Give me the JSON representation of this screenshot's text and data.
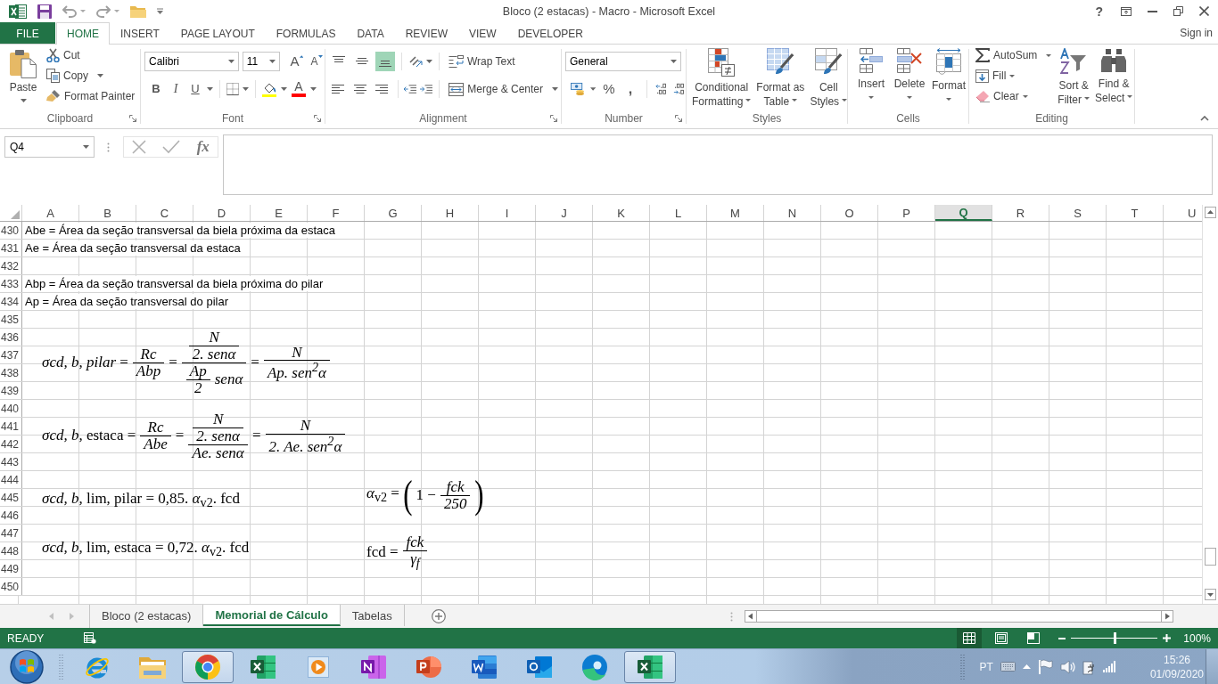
{
  "window": {
    "title": "Bloco (2 estacas) - Macro - Microsoft Excel",
    "help": "?"
  },
  "tabs": [
    {
      "label": "FILE",
      "kind": "file",
      "selected": false
    },
    {
      "label": "HOME",
      "kind": "tab",
      "selected": true
    },
    {
      "label": "INSERT",
      "kind": "tab",
      "selected": false
    },
    {
      "label": "PAGE LAYOUT",
      "kind": "tab",
      "selected": false
    },
    {
      "label": "FORMULAS",
      "kind": "tab",
      "selected": false
    },
    {
      "label": "DATA",
      "kind": "tab",
      "selected": false
    },
    {
      "label": "REVIEW",
      "kind": "tab",
      "selected": false
    },
    {
      "label": "VIEW",
      "kind": "tab",
      "selected": false
    },
    {
      "label": "DEVELOPER",
      "kind": "tab",
      "selected": false
    }
  ],
  "account": {
    "label": "Sign in"
  },
  "ribbon": {
    "clipboard": {
      "label": "Clipboard",
      "paste": "Paste",
      "cut": "Cut",
      "copy": "Copy",
      "format_painter": "Format Painter"
    },
    "font": {
      "label": "Font",
      "font_name": "Calibri",
      "font_size": "11",
      "grow": "A",
      "shrink": "A",
      "bold": "B",
      "italic": "I",
      "underline": "U",
      "font_color": "A"
    },
    "alignment": {
      "label": "Alignment",
      "vertical": [
        {
          "kind": "top",
          "selected": false
        },
        {
          "kind": "middle",
          "selected": false
        },
        {
          "kind": "bottom",
          "selected": true
        }
      ],
      "horizontal": [
        {
          "kind": "left",
          "selected": false
        },
        {
          "kind": "center",
          "selected": false
        },
        {
          "kind": "right",
          "selected": false
        }
      ],
      "wrap_text": "Wrap Text",
      "merge": "Merge & Center"
    },
    "number": {
      "label": "Number",
      "format": "General",
      "percent": "%",
      "comma": ","
    },
    "styles": {
      "label": "Styles",
      "buttons": [
        {
          "kind": "conditional",
          "lines": [
            "Conditional",
            "Formatting"
          ]
        },
        {
          "kind": "table",
          "lines": [
            "Format as",
            "Table"
          ]
        },
        {
          "kind": "cell",
          "lines": [
            "Cell",
            "Styles"
          ]
        }
      ]
    },
    "cells": {
      "label": "Cells",
      "buttons": [
        {
          "kind": "insert",
          "label": "Insert"
        },
        {
          "kind": "delete",
          "label": "Delete"
        },
        {
          "kind": "format",
          "label": "Format"
        }
      ]
    },
    "editing": {
      "label": "Editing",
      "autosum": "AutoSum",
      "fill": "Fill",
      "clear": "Clear",
      "buttons": [
        {
          "kind": "sort",
          "lines": [
            "Sort &",
            "Filter"
          ]
        },
        {
          "kind": "find",
          "lines": [
            "Find &",
            "Select"
          ]
        }
      ]
    }
  },
  "formula_bar": {
    "name_box": "Q4",
    "function_label": "fx"
  },
  "sheet": {
    "columns": [
      {
        "label": "A",
        "selected": false
      },
      {
        "label": "B",
        "selected": false
      },
      {
        "label": "C",
        "selected": false
      },
      {
        "label": "D",
        "selected": false
      },
      {
        "label": "E",
        "selected": false
      },
      {
        "label": "F",
        "selected": false
      },
      {
        "label": "G",
        "selected": false
      },
      {
        "label": "H",
        "selected": false
      },
      {
        "label": "I",
        "selected": false
      },
      {
        "label": "J",
        "selected": false
      },
      {
        "label": "K",
        "selected": false
      },
      {
        "label": "L",
        "selected": false
      },
      {
        "label": "M",
        "selected": false
      },
      {
        "label": "N",
        "selected": false
      },
      {
        "label": "O",
        "selected": false
      },
      {
        "label": "P",
        "selected": false
      },
      {
        "label": "Q",
        "selected": true
      },
      {
        "label": "R",
        "selected": false
      },
      {
        "label": "S",
        "selected": false
      },
      {
        "label": "T",
        "selected": false
      },
      {
        "label": "U",
        "selected": false
      }
    ],
    "rows": [
      {
        "number": "430",
        "text": "Abe = Área da seção transversal da biela próxima da estaca"
      },
      {
        "number": "431",
        "text": "Ae = Área da seção transversal da estaca"
      },
      {
        "number": "432"
      },
      {
        "number": "433",
        "text": "Abp = Área da seção transversal da biela próxima do pilar"
      },
      {
        "number": "434",
        "text": "Ap = Área da seção transversal do pilar"
      },
      {
        "number": "435"
      },
      {
        "number": "436"
      },
      {
        "number": "437"
      },
      {
        "number": "438"
      },
      {
        "number": "439"
      },
      {
        "number": "440"
      },
      {
        "number": "441"
      },
      {
        "number": "442"
      },
      {
        "number": "443"
      },
      {
        "number": "444"
      },
      {
        "number": "445"
      },
      {
        "number": "446"
      },
      {
        "number": "447"
      },
      {
        "number": "448"
      },
      {
        "number": "449"
      },
      {
        "number": "450"
      }
    ],
    "equations": [
      {
        "parts": [
          {
            "kind": "text",
            "text": "*σcd, b, pilar* ="
          },
          {
            "kind": "frac",
            "num": [
              {
                "kind": "text",
                "text": "Rc"
              }
            ],
            "den": [
              {
                "kind": "text",
                "text": "Abp"
              }
            ]
          },
          {
            "kind": "text",
            "text": "="
          },
          {
            "kind": "frac",
            "num": [
              {
                "kind": "frac",
                "num": [
                  {
                    "kind": "text",
                    "text": "N"
                  }
                ],
                "den": [
                  {
                    "kind": "text",
                    "text": "2. senα"
                  }
                ]
              }
            ],
            "den": [
              {
                "kind": "frac",
                "num": [
                  {
                    "kind": "text",
                    "text": "Ap"
                  }
                ],
                "den": [
                  {
                    "kind": "text",
                    "text": "2"
                  }
                ]
              },
              {
                "kind": "text",
                "text": "senα"
              }
            ]
          },
          {
            "kind": "text",
            "text": "="
          },
          {
            "kind": "frac",
            "num": [
              {
                "kind": "text",
                "text": "N"
              }
            ],
            "den": [
              {
                "kind": "text",
                "text": "Ap. sen$^{2}$α"
              }
            ]
          }
        ]
      },
      {
        "parts": [
          {
            "kind": "text",
            "text": "*σcd, b,* estaca ="
          },
          {
            "kind": "frac",
            "num": [
              {
                "kind": "text",
                "text": "Rc"
              }
            ],
            "den": [
              {
                "kind": "text",
                "text": "Abe"
              }
            ]
          },
          {
            "kind": "text",
            "text": "="
          },
          {
            "kind": "frac",
            "num": [
              {
                "kind": "frac",
                "num": [
                  {
                    "kind": "text",
                    "text": "N"
                  }
                ],
                "den": [
                  {
                    "kind": "text",
                    "text": "2. senα"
                  }
                ]
              }
            ],
            "den": [
              {
                "kind": "text",
                "text": "Ae. senα"
              }
            ]
          },
          {
            "kind": "text",
            "text": "="
          },
          {
            "kind": "frac",
            "num": [
              {
                "kind": "text",
                "text": "N"
              }
            ],
            "den": [
              {
                "kind": "text",
                "text": "2. Ae. sen$^{2}$α"
              }
            ]
          }
        ]
      },
      {
        "parts": [
          {
            "kind": "text",
            "text": "*σcd, b,* lim, pilar = 0,85. *α*$_{v2}$. fcd"
          }
        ]
      },
      {
        "parts": [
          {
            "kind": "text",
            "text": "*σcd, b,* lim, estaca = 0,72. *α*$_{v2}$. fcd"
          }
        ]
      },
      {
        "parts": [
          {
            "kind": "text",
            "text": "*α*$_{v2}$ ="
          },
          {
            "kind": "paren",
            "open": "(",
            "close": ")",
            "body": [
              {
                "kind": "text",
                "text": "1 −"
              },
              {
                "kind": "frac",
                "num": [
                  {
                    "kind": "text",
                    "text": "fck"
                  }
                ],
                "den": [
                  {
                    "kind": "text",
                    "text": "250"
                  }
                ]
              }
            ]
          }
        ]
      },
      {
        "parts": [
          {
            "kind": "text",
            "text": "fcd ="
          },
          {
            "kind": "frac",
            "num": [
              {
                "kind": "text",
                "text": "fck"
              }
            ],
            "den": [
              {
                "kind": "text",
                "text": "γ$_{f}$"
              }
            ]
          }
        ]
      }
    ]
  },
  "sheet_tabs": [
    {
      "label": "Bloco (2 estacas)",
      "selected": false
    },
    {
      "label": "Memorial de Cálculo",
      "selected": true
    },
    {
      "label": "Tabelas",
      "selected": false
    }
  ],
  "status_bar": {
    "mode": "READY",
    "views": [
      {
        "kind": "normal",
        "selected": true
      },
      {
        "kind": "page_layout",
        "selected": false
      },
      {
        "kind": "page_break",
        "selected": false
      }
    ],
    "zoom": {
      "level": 0.5,
      "reading": "100%"
    }
  },
  "taskbar": {
    "apps": [
      {
        "kind": "ie",
        "running": false
      },
      {
        "kind": "explorer",
        "running": false
      },
      {
        "kind": "chrome",
        "running": true
      },
      {
        "kind": "excel",
        "running": false
      },
      {
        "kind": "media",
        "running": false
      },
      {
        "kind": "onenote",
        "running": false
      },
      {
        "kind": "powerpoint",
        "running": false
      },
      {
        "kind": "word",
        "running": false
      },
      {
        "kind": "outlook",
        "running": false
      },
      {
        "kind": "edge",
        "running": false
      },
      {
        "kind": "excel",
        "running": true
      }
    ],
    "language": "PT",
    "time": "15:26",
    "date": "01/09/2020"
  }
}
